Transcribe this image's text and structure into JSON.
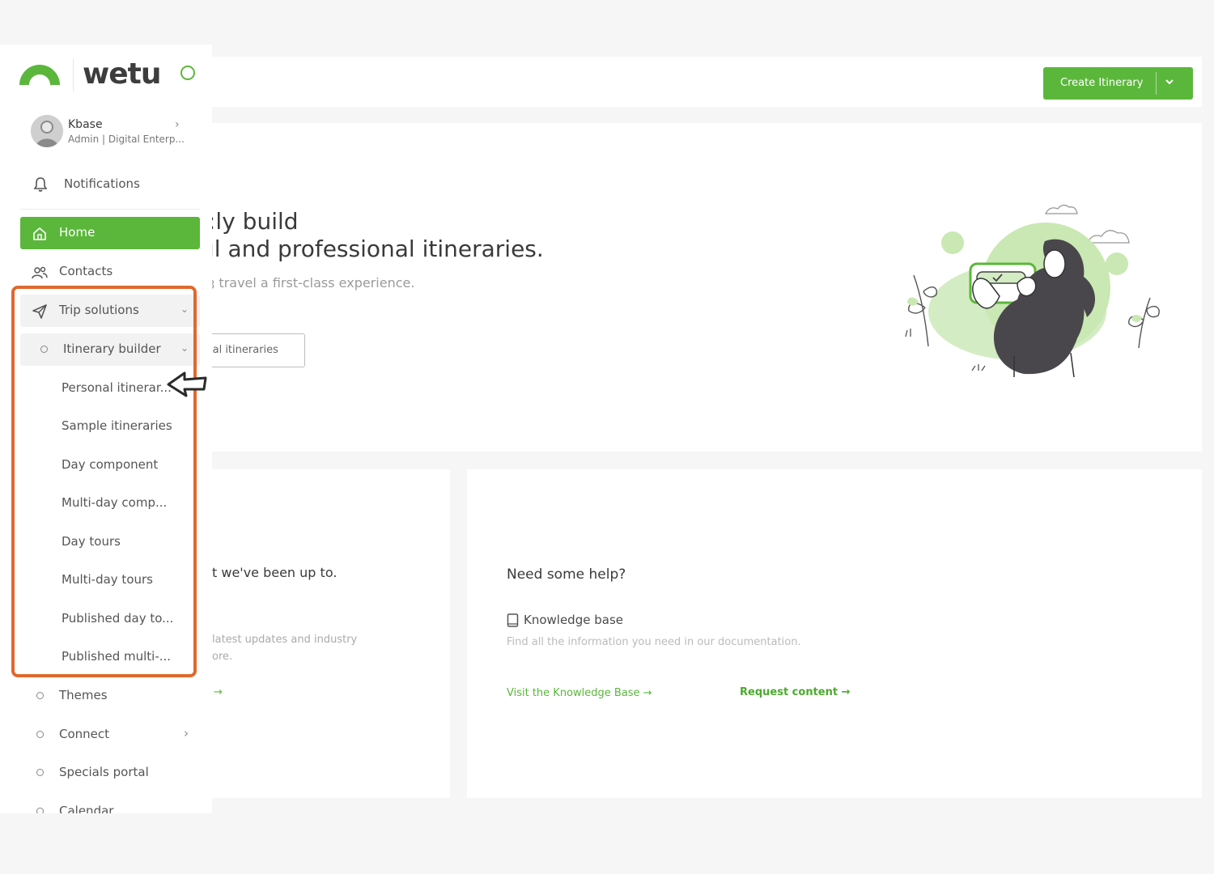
{
  "colors": {
    "accent": "#5bb73b",
    "highlight": "#e0692f"
  },
  "brand": {
    "logo_text": "wetu"
  },
  "profile": {
    "name": "Kbase",
    "role": "Admin | Digital Enterp..."
  },
  "sidebar": {
    "notifications": "Notifications",
    "home": "Home",
    "contacts": "Contacts",
    "trip_solutions": "Trip solutions",
    "itinerary_builder": "Itinerary builder",
    "sub_items": [
      "Personal itinerar...",
      "Sample itineraries",
      "Day component",
      "Multi-day comp...",
      "Day tours",
      "Multi-day tours",
      "Published day to...",
      "Published multi-..."
    ],
    "themes": "Themes",
    "connect": "Connect",
    "specials_portal": "Specials portal",
    "calendar": "Calendar"
  },
  "topbar": {
    "create_label": "Create Itinerary"
  },
  "hero": {
    "line1": ":ly build",
    "line2": "ıl and professional itineraries.",
    "sub": "ȝ travel a first-class experience.",
    "button": "ıal itineraries"
  },
  "updates_card": {
    "title": "t we've been up to.",
    "desc1": "latest updates and industry",
    "desc2": "ore.",
    "arrow": "→"
  },
  "help_card": {
    "title": "Need some help?",
    "kb_label": "Knowledge base",
    "desc": "Find all the information you need in our documentation.",
    "kb_link": "Visit the Knowledge Base  →",
    "request_link": "Request content →"
  }
}
